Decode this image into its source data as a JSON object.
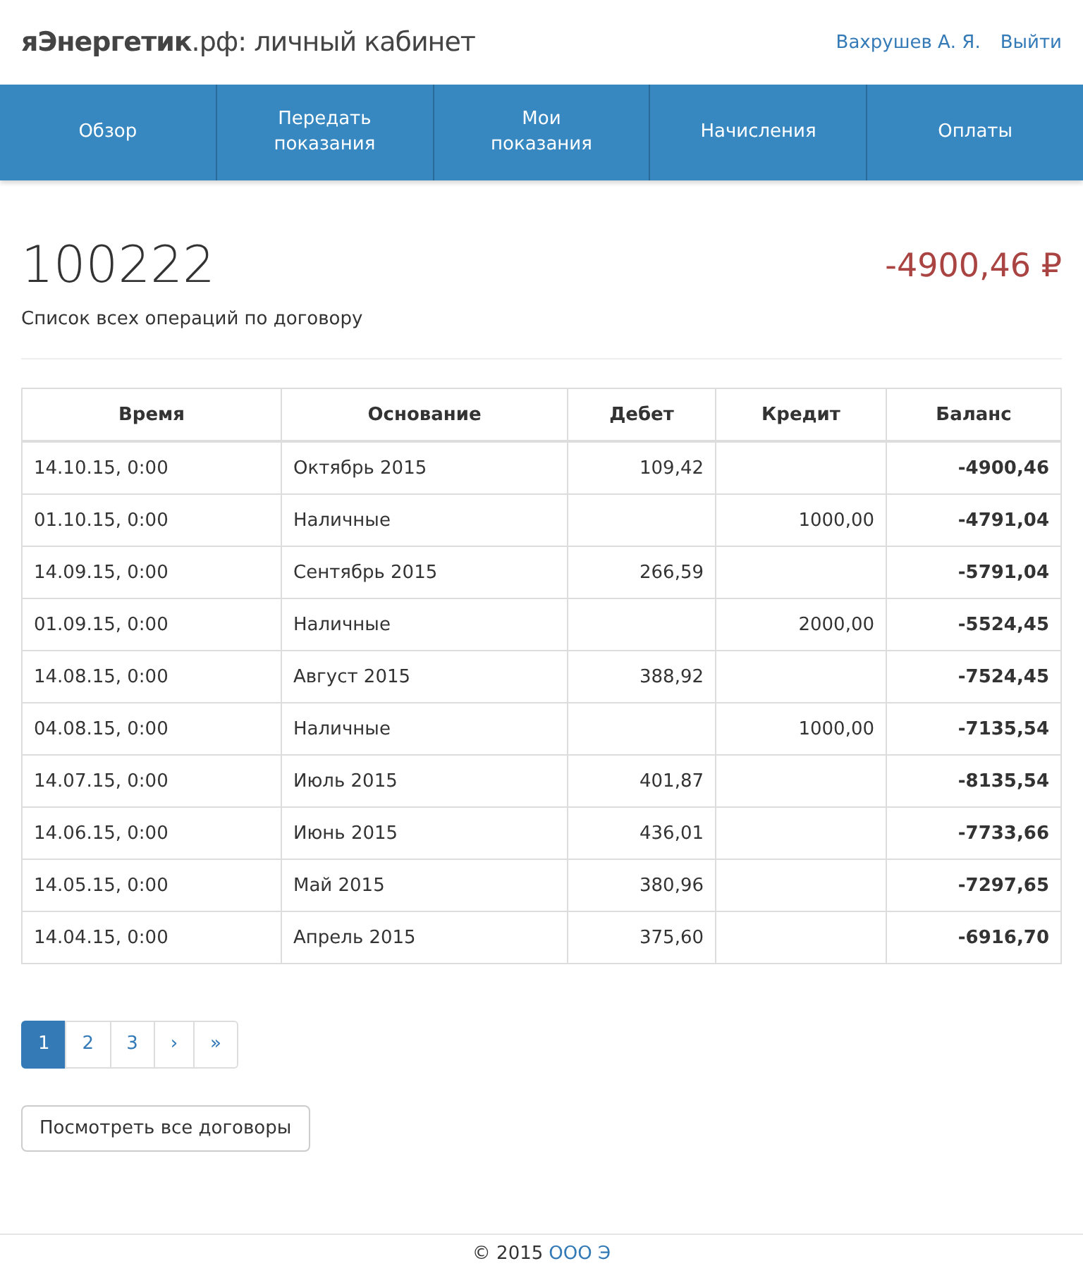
{
  "header": {
    "brand_bold": "яЭнергетик",
    "brand_light": ".рф: личный кабинет",
    "user": "Вахрушев А. Я.",
    "logout": "Выйти"
  },
  "nav": [
    {
      "label": "Обзор",
      "selected": false
    },
    {
      "label": "Передать показания",
      "selected": false
    },
    {
      "label": "Мои показания",
      "selected": false
    },
    {
      "label": "Начисления",
      "selected": false
    },
    {
      "label": "Оплаты",
      "selected": false
    }
  ],
  "account": {
    "number": "100222",
    "subtitle": "Список всех операций по договору",
    "balance": "-4900,46",
    "currency": "₽"
  },
  "table": {
    "columns": [
      "Время",
      "Основание",
      "Дебет",
      "Кредит",
      "Баланс"
    ],
    "rows": [
      [
        "14.10.15, 0:00",
        "Октябрь 2015",
        "109,42",
        "",
        "-4900,46"
      ],
      [
        "01.10.15, 0:00",
        "Наличные",
        "",
        "1000,00",
        "-4791,04"
      ],
      [
        "14.09.15, 0:00",
        "Сентябрь 2015",
        "266,59",
        "",
        "-5791,04"
      ],
      [
        "01.09.15, 0:00",
        "Наличные",
        "",
        "2000,00",
        "-5524,45"
      ],
      [
        "14.08.15, 0:00",
        "Август 2015",
        "388,92",
        "",
        "-7524,45"
      ],
      [
        "04.08.15, 0:00",
        "Наличные",
        "",
        "1000,00",
        "-7135,54"
      ],
      [
        "14.07.15, 0:00",
        "Июль 2015",
        "401,87",
        "",
        "-8135,54"
      ],
      [
        "14.06.15, 0:00",
        "Июнь 2015",
        "436,01",
        "",
        "-7733,66"
      ],
      [
        "14.05.15, 0:00",
        "Май 2015",
        "380,96",
        "",
        "-7297,65"
      ],
      [
        "14.04.15, 0:00",
        "Апрель 2015",
        "375,60",
        "",
        "-6916,70"
      ]
    ]
  },
  "pagination": [
    {
      "label": "1",
      "selected": true
    },
    {
      "label": "2",
      "selected": false
    },
    {
      "label": "3",
      "selected": false
    },
    {
      "label": "›",
      "selected": false
    },
    {
      "label": "»",
      "selected": false
    }
  ],
  "all_contracts_button": "Посмотреть все договоры",
  "footer": {
    "text": "© 2015",
    "link": "ООО Э"
  }
}
